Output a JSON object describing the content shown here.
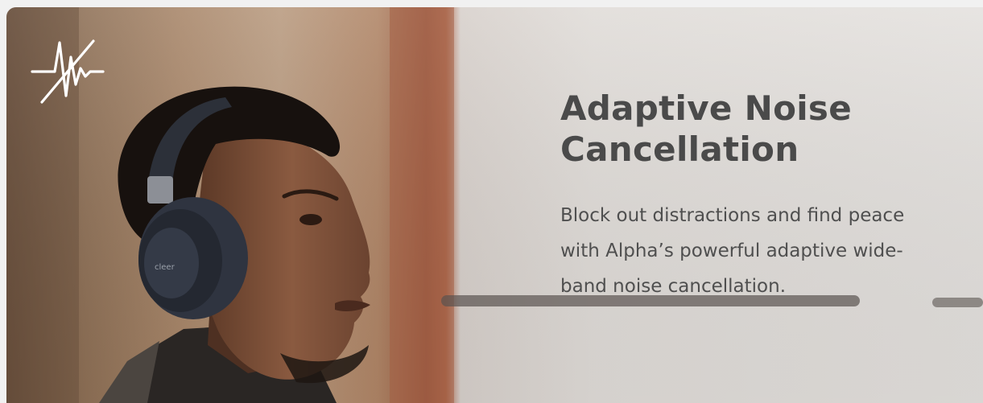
{
  "banner": {
    "title": "Adaptive  Noise\nCancellation",
    "description": "Block out distractions and find peace with Alpha’s powerful adaptive wide-band noise cancellation.",
    "headphone_brand": "cleer",
    "icons": {
      "logo": "noise-cancel-wave-icon"
    },
    "colors": {
      "title": "#4a4a4a",
      "text": "#4f4f4f",
      "logo": "#ffffff",
      "wall_left": "#b89a7f",
      "wall_right": "#e2dfdc",
      "headphones": "#2f3440"
    }
  }
}
